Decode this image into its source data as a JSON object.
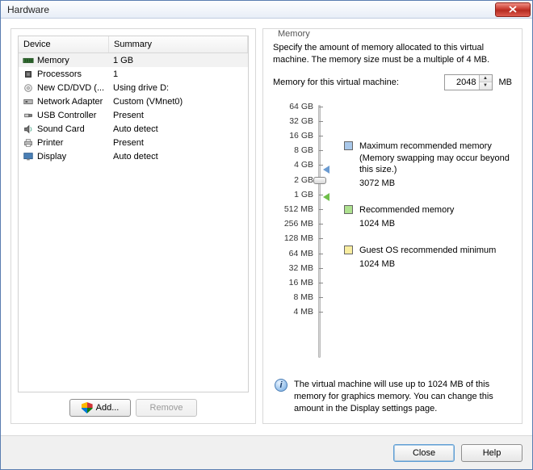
{
  "window": {
    "title": "Hardware"
  },
  "device_table": {
    "headers": {
      "device": "Device",
      "summary": "Summary"
    },
    "rows": [
      {
        "name": "Memory",
        "summary": "1 GB",
        "icon": "memory",
        "selected": true
      },
      {
        "name": "Processors",
        "summary": "1",
        "icon": "cpu"
      },
      {
        "name": "New CD/DVD (...",
        "summary": "Using drive D:",
        "icon": "cd"
      },
      {
        "name": "Network Adapter",
        "summary": "Custom (VMnet0)",
        "icon": "nic"
      },
      {
        "name": "USB Controller",
        "summary": "Present",
        "icon": "usb"
      },
      {
        "name": "Sound Card",
        "summary": "Auto detect",
        "icon": "sound"
      },
      {
        "name": "Printer",
        "summary": "Present",
        "icon": "printer"
      },
      {
        "name": "Display",
        "summary": "Auto detect",
        "icon": "display"
      }
    ]
  },
  "left_buttons": {
    "add": "Add...",
    "remove": "Remove"
  },
  "memory_panel": {
    "group_label": "Memory",
    "spec": "Specify the amount of memory allocated to this virtual machine. The memory size must be a multiple of 4 MB.",
    "input_label": "Memory for this virtual machine:",
    "value": "2048",
    "unit": "MB",
    "ticks": [
      "64 GB",
      "32 GB",
      "16 GB",
      "8 GB",
      "4 GB",
      "2 GB",
      "1 GB",
      "512 MB",
      "256 MB",
      "128 MB",
      "64 MB",
      "32 MB",
      "16 MB",
      "8 MB",
      "4 MB"
    ],
    "legend": {
      "max": {
        "label": "Maximum recommended memory",
        "note": "(Memory swapping may occur beyond this size.)",
        "value": "3072 MB"
      },
      "rec": {
        "label": "Recommended memory",
        "value": "1024 MB"
      },
      "min": {
        "label": "Guest OS recommended minimum",
        "value": "1024 MB"
      }
    },
    "info": "The virtual machine will use up to 1024 MB of this memory for graphics memory. You can change this amount in the Display settings page."
  },
  "dialog_buttons": {
    "close": "Close",
    "help": "Help"
  }
}
